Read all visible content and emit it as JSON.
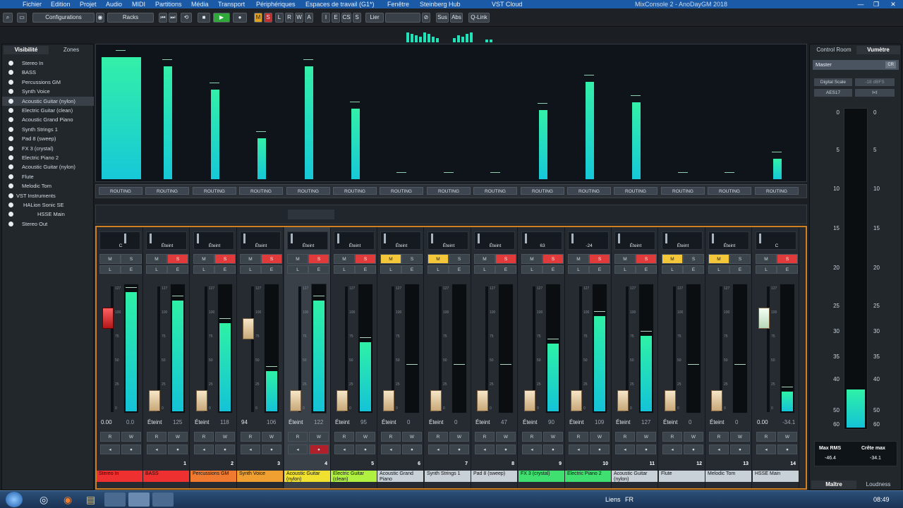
{
  "menubar": {
    "items": [
      "Fichier",
      "Edition",
      "Projet",
      "Audio",
      "MIDI",
      "Partitions",
      "Média",
      "Transport",
      "Périphériques",
      "Espaces de travail (G1*)",
      "Fenêtre",
      "Steinberg Hub",
      "VST Cloud"
    ],
    "window_title": "MixConsole 2 - AnoDayGM 2018",
    "win_min": "—",
    "win_max": "❐",
    "win_close": "✕"
  },
  "toolbar": {
    "configurations": "Configurations",
    "racks": "Racks",
    "lier": "Lier",
    "sus": "Sus",
    "abs": "Abs",
    "qlink": "Q-Link",
    "m": "M",
    "s": "S",
    "l": "L",
    "r": "R",
    "w": "W",
    "a": "A",
    "i": "I",
    "e": "E",
    "cs": "CS",
    "s2": "S"
  },
  "left_panel": {
    "tabs": [
      "Visibilité",
      "Zones"
    ],
    "items": [
      "Stereo In",
      "BASS",
      "Percussions GM",
      "Synth Voice",
      "Acoustic Guitar (nylon)",
      "Electric Guitar (clean)",
      "Acoustic Grand Piano",
      "Synth Strings 1",
      "Pad 8 (sweep)",
      "FX 3 (crystal)",
      "Electric Piano 2",
      "Acoustic Guitar (nylon)",
      "Flute",
      "Melodic Tom",
      "VST Instruments",
      "HALion Sonic SE",
      "HSSE Main",
      "Stereo Out"
    ],
    "selected_index": 4
  },
  "routing_label": "ROUTING",
  "channels": [
    {
      "name": "Stereo In",
      "num": "",
      "color": "#ee3030",
      "pan": "C",
      "m": false,
      "s": false,
      "vol": "0.00",
      "peak": "0.0",
      "level": 0.95,
      "fader": 0.8,
      "cap": "red",
      "rec": false,
      "mon": false
    },
    {
      "name": "BASS",
      "num": "1",
      "color": "#ee3030",
      "pan": "Éteint",
      "m": false,
      "s": true,
      "vol": "Éteint",
      "peak": "125",
      "level": 0.88,
      "fader": 0.02,
      "cap": "",
      "rec": false,
      "mon": false
    },
    {
      "name": "Percussions GM",
      "num": "2",
      "color": "#f07a30",
      "pan": "Éteint",
      "m": false,
      "s": true,
      "vol": "Éteint",
      "peak": "118",
      "level": 0.7,
      "fader": 0.02,
      "cap": "",
      "rec": false,
      "mon": false
    },
    {
      "name": "Synth Voice",
      "num": "3",
      "color": "#f0a030",
      "pan": "Éteint",
      "m": false,
      "s": true,
      "vol": "94",
      "peak": "106",
      "level": 0.32,
      "fader": 0.7,
      "cap": "",
      "rec": false,
      "mon": false
    },
    {
      "name": "Acoustic Guitar (nylon)",
      "num": "4",
      "color": "#f0e030",
      "pan": "Éteint",
      "m": false,
      "s": true,
      "vol": "Éteint",
      "peak": "122",
      "level": 0.88,
      "fader": 0.02,
      "cap": "",
      "rec": true,
      "mon": true
    },
    {
      "name": "Electric Guitar (clean)",
      "num": "5",
      "color": "#b0f040",
      "pan": "Éteint",
      "m": false,
      "s": true,
      "vol": "Éteint",
      "peak": "95",
      "level": 0.55,
      "fader": 0.02,
      "cap": "",
      "rec": false,
      "mon": false
    },
    {
      "name": "Acoustic Grand Piano",
      "num": "6",
      "color": "#c8d0d8",
      "pan": "Éteint",
      "m": true,
      "s": false,
      "vol": "Éteint",
      "peak": "0",
      "level": 0,
      "fader": 0.02,
      "cap": "",
      "rec": false,
      "mon": false
    },
    {
      "name": "Synth Strings 1",
      "num": "7",
      "color": "#c8d0d8",
      "pan": "Éteint",
      "m": true,
      "s": false,
      "vol": "Éteint",
      "peak": "0",
      "level": 0,
      "fader": 0.02,
      "cap": "",
      "rec": false,
      "mon": false
    },
    {
      "name": "Pad 8 (sweep)",
      "num": "8",
      "color": "#c8d0d8",
      "pan": "Éteint",
      "m": false,
      "s": true,
      "vol": "Éteint",
      "peak": "47",
      "level": 0,
      "fader": 0.02,
      "cap": "",
      "rec": false,
      "mon": false
    },
    {
      "name": "FX 3 (crystal)",
      "num": "9",
      "color": "#40e070",
      "pan": "63",
      "m": false,
      "s": true,
      "vol": "Éteint",
      "peak": "90",
      "level": 0.54,
      "fader": 0.02,
      "cap": "",
      "rec": false,
      "mon": false
    },
    {
      "name": "Electric Piano 2",
      "num": "10",
      "color": "#40e070",
      "pan": "-24",
      "m": false,
      "s": true,
      "vol": "Éteint",
      "peak": "109",
      "level": 0.76,
      "fader": 0.02,
      "cap": "",
      "rec": false,
      "mon": false
    },
    {
      "name": "Acoustic Guitar (nylon)",
      "num": "11",
      "color": "#c8d0d8",
      "pan": "Éteint",
      "m": false,
      "s": true,
      "vol": "Éteint",
      "peak": "127",
      "level": 0.6,
      "fader": 0.02,
      "cap": "",
      "rec": false,
      "mon": false
    },
    {
      "name": "Flute",
      "num": "12",
      "color": "#c8d0d8",
      "pan": "Éteint",
      "m": true,
      "s": false,
      "vol": "Éteint",
      "peak": "0",
      "level": 0,
      "fader": 0.02,
      "cap": "",
      "rec": false,
      "mon": false
    },
    {
      "name": "Melodic Tom",
      "num": "13",
      "color": "#c8d0d8",
      "pan": "Éteint",
      "m": true,
      "s": false,
      "vol": "Éteint",
      "peak": "0",
      "level": 0,
      "fader": 0.02,
      "cap": "",
      "rec": false,
      "mon": false
    },
    {
      "name": "HSSE Main",
      "num": "14",
      "color": "#c8d0d8",
      "pan": "C",
      "m": false,
      "s": true,
      "vol": "0.00",
      "peak": "-34.1",
      "level": 0.16,
      "fader": 0.8,
      "cap": "wht",
      "rec": false,
      "mon": false
    }
  ],
  "scale_labels": [
    "127",
    "100",
    "75",
    "50",
    "25",
    "0"
  ],
  "right_panel": {
    "tabs": [
      "Control Room",
      "Vumètre"
    ],
    "master": "Master",
    "cr": "CR",
    "digital_scale": "Digital Scale",
    "dbfs": "-18 dBFS",
    "aes": "AES17",
    "hold": "I<I",
    "scale": [
      "0",
      "5",
      "10",
      "15",
      "20",
      "25",
      "30",
      "35",
      "40",
      "50",
      "60"
    ],
    "max_rms_label": "Max RMS",
    "max_rms": "-46.4",
    "crest_label": "Crête max",
    "crest": "-34.1",
    "bottom_tabs": [
      "Maître",
      "Loudness"
    ],
    "meter_level": 0.12
  },
  "taskbar": {
    "tray": "Liens",
    "lang": "FR",
    "time": "08:49"
  },
  "colors": {
    "accent": "#d08020",
    "meter": "#22e0b8"
  }
}
